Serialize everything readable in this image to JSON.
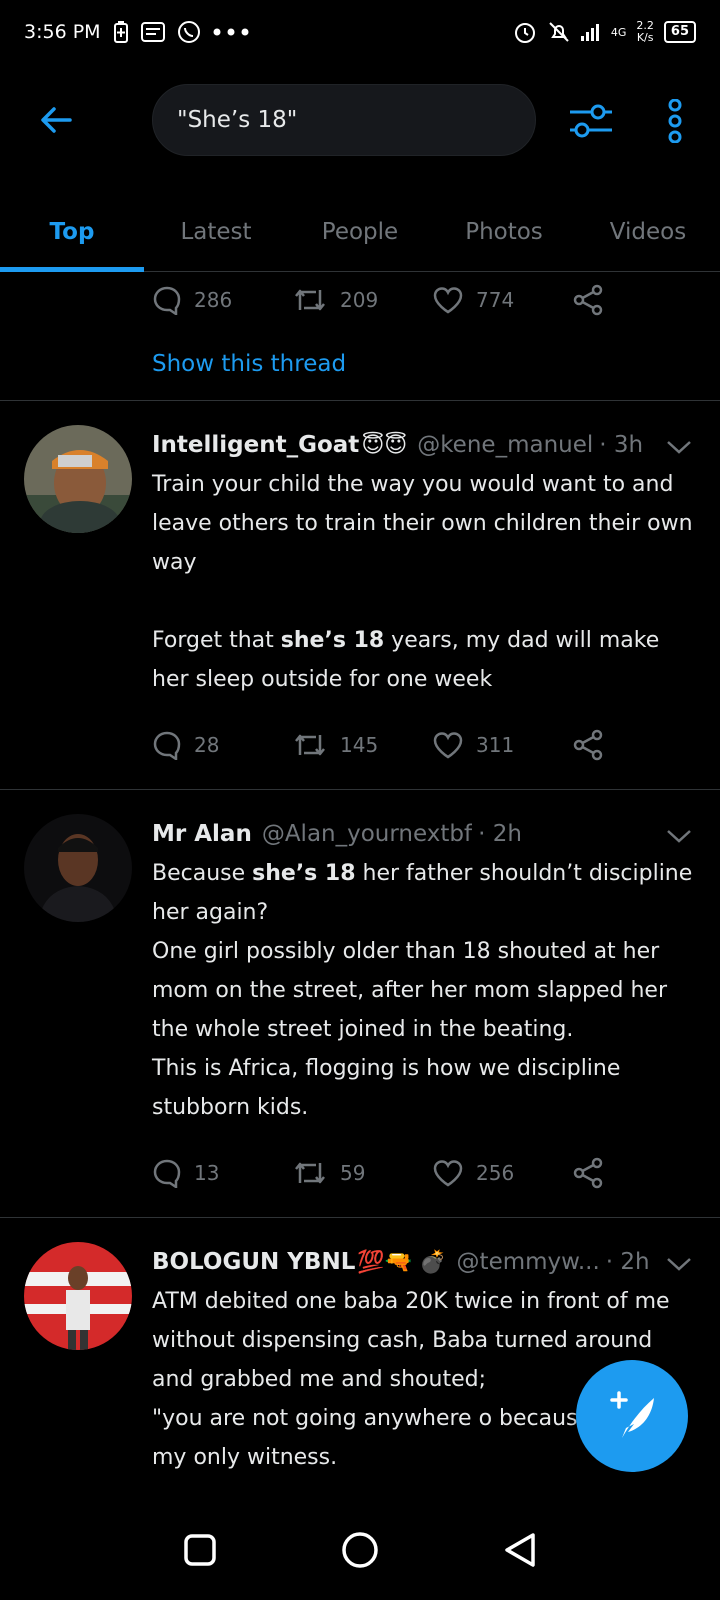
{
  "status_bar": {
    "time": "3:56 PM",
    "network_label": "4G",
    "net_speed_value": "2.2",
    "net_speed_unit": "K/s",
    "battery": "65"
  },
  "header": {
    "search_query": "\"She’s 18\""
  },
  "tabs": [
    {
      "label": "Top",
      "active": true
    },
    {
      "label": "Latest",
      "active": false
    },
    {
      "label": "People",
      "active": false
    },
    {
      "label": "Photos",
      "active": false
    },
    {
      "label": "Videos",
      "active": false
    }
  ],
  "prev_tweet": {
    "replies": "286",
    "retweets": "209",
    "likes": "774",
    "show_thread_label": "Show this thread"
  },
  "tweets": [
    {
      "name": "Intelligent_Goat",
      "emoji": "😇😇",
      "handle": "@kene_manuel",
      "time": "· 3h",
      "body_1": "Train your child the way you would want to and leave others to train their own children their own way\n\nForget that ",
      "body_bold": "she’s 18",
      "body_2": " years, my dad will make her sleep outside for one week",
      "replies": "28",
      "retweets": "145",
      "likes": "311"
    },
    {
      "name": "Mr Alan",
      "emoji": "",
      "handle": "@Alan_yournextbf",
      "time": "· 2h",
      "body_1": "Because ",
      "body_bold": "she’s 18",
      "body_2": " her father shouldn’t discipline her again?\nOne girl possibly older than 18 shouted at her mom on the street, after her mom slapped her the whole street joined in the beating.\nThis is Africa, flogging is how we discipline stubborn kids.",
      "replies": "13",
      "retweets": "59",
      "likes": "256"
    },
    {
      "name": "BOLOGUN YBNL",
      "emoji": "💯🔫 💣",
      "handle": "@temmyw...",
      "time": "· 2h",
      "body_1": "ATM debited one baba 20K twice in front of me without dispensing cash, Baba turned around and grabbed me and shouted;\n\"you are not going anywhere o because you are my only witness.",
      "body_bold": "",
      "body_2": ""
    }
  ],
  "colors": {
    "accent": "#1d9bf0",
    "background": "#000000",
    "muted": "#71767b",
    "divider": "#2f3336"
  },
  "icons": {
    "back": "arrow-left-icon",
    "filter": "sliders-icon",
    "more": "more-vertical-icon",
    "reply": "comment-icon",
    "retweet": "retweet-icon",
    "like": "heart-icon",
    "share": "share-icon",
    "compose": "feather-plus-icon",
    "nav_recents": "square-icon",
    "nav_home": "circle-icon",
    "nav_back": "triangle-back-icon"
  }
}
